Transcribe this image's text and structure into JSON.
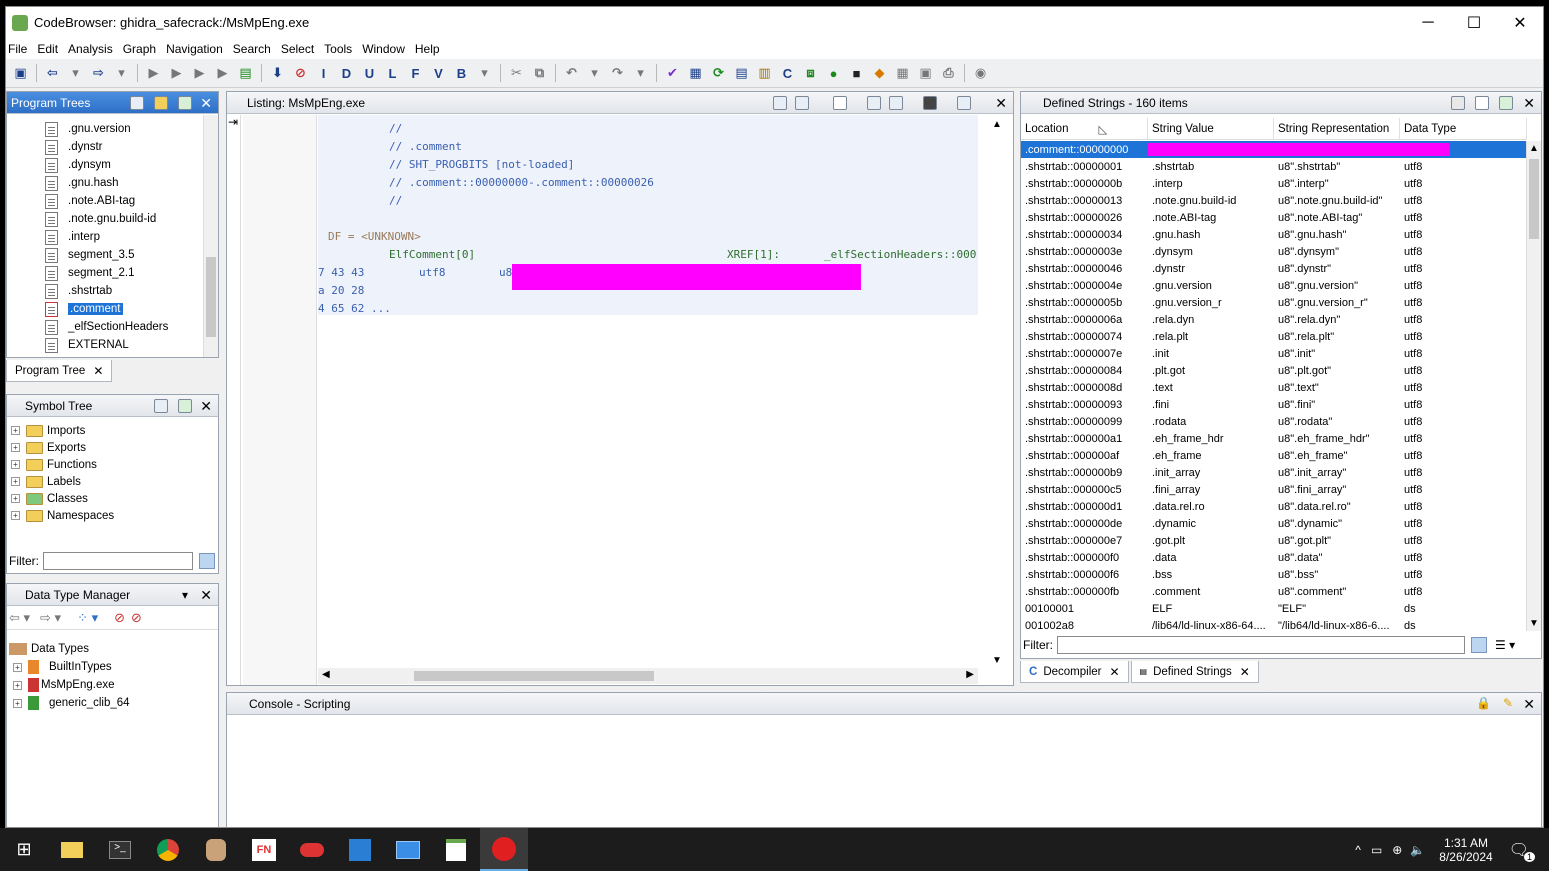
{
  "window": {
    "title": "CodeBrowser: ghidra_safecrack:/MsMpEng.exe",
    "minimize": "─",
    "maximize": "☐",
    "close": "✕"
  },
  "menu": [
    "File",
    "Edit",
    "Analysis",
    "Graph",
    "Navigation",
    "Search",
    "Select",
    "Tools",
    "Window",
    "Help"
  ],
  "toolbar_glyphs": [
    "I",
    "D",
    "U",
    "L",
    "F",
    "V",
    "B"
  ],
  "program_trees": {
    "title": "Program Trees",
    "items": [
      ".gnu.version",
      ".dynstr",
      ".dynsym",
      ".gnu.hash",
      ".note.ABI-tag",
      ".note.gnu.build-id",
      ".interp",
      "segment_3.5",
      "segment_2.1",
      ".shstrtab",
      ".comment",
      "_elfSectionHeaders",
      "EXTERNAL"
    ],
    "selected": ".comment",
    "tab_label": "Program Tree"
  },
  "symbol_tree": {
    "title": "Symbol Tree",
    "items": [
      "Imports",
      "Exports",
      "Functions",
      "Labels",
      "Classes",
      "Namespaces"
    ],
    "filter_label": "Filter:"
  },
  "data_type_manager": {
    "title": "Data Type Manager",
    "root": "Data Types",
    "items": [
      "BuiltInTypes",
      "MsMpEng.exe",
      "generic_clib_64"
    ]
  },
  "listing": {
    "title": "Listing:  MsMpEng.exe",
    "lines": [
      {
        "text": "//",
        "cls": "cmt"
      },
      {
        "text": "// .comment",
        "cls": "cmt"
      },
      {
        "text": "// SHT_PROGBITS [not-loaded]",
        "cls": "cmt"
      },
      {
        "text": "// .comment::00000000-.comment::00000026",
        "cls": "cmt"
      },
      {
        "text": "//",
        "cls": "cmt"
      },
      {
        "text": "DF = <UNKNOWN>",
        "cls": "grey"
      },
      {
        "text": "ElfComment[0]",
        "cls": "lbl"
      },
      {
        "text": "XREF[1]:",
        "cls": "lbl"
      },
      {
        "text": "_elfSectionHeaders::000",
        "cls": "lbl"
      },
      {
        "text": "7 43 43",
        "cls": "cmt"
      },
      {
        "text": "utf8",
        "cls": "cmt"
      },
      {
        "text": "u8",
        "cls": "cmt"
      },
      {
        "text": "a 20 28",
        "cls": "cmt"
      },
      {
        "text": "4 65 62 ...",
        "cls": "cmt"
      }
    ]
  },
  "defined_strings": {
    "title": "Defined Strings - 160 items",
    "columns": [
      "Location",
      "String Value",
      "String Representation",
      "Data Type"
    ],
    "rows": [
      {
        "loc": ".comment::00000000",
        "val": "",
        "rep": "",
        "type": ""
      },
      {
        "loc": ".shstrtab::00000001",
        "val": ".shstrtab",
        "rep": "u8\".shstrtab\"",
        "type": "utf8"
      },
      {
        "loc": ".shstrtab::0000000b",
        "val": ".interp",
        "rep": "u8\".interp\"",
        "type": "utf8"
      },
      {
        "loc": ".shstrtab::00000013",
        "val": ".note.gnu.build-id",
        "rep": "u8\".note.gnu.build-id\"",
        "type": "utf8"
      },
      {
        "loc": ".shstrtab::00000026",
        "val": ".note.ABI-tag",
        "rep": "u8\".note.ABI-tag\"",
        "type": "utf8"
      },
      {
        "loc": ".shstrtab::00000034",
        "val": ".gnu.hash",
        "rep": "u8\".gnu.hash\"",
        "type": "utf8"
      },
      {
        "loc": ".shstrtab::0000003e",
        "val": ".dynsym",
        "rep": "u8\".dynsym\"",
        "type": "utf8"
      },
      {
        "loc": ".shstrtab::00000046",
        "val": ".dynstr",
        "rep": "u8\".dynstr\"",
        "type": "utf8"
      },
      {
        "loc": ".shstrtab::0000004e",
        "val": ".gnu.version",
        "rep": "u8\".gnu.version\"",
        "type": "utf8"
      },
      {
        "loc": ".shstrtab::0000005b",
        "val": ".gnu.version_r",
        "rep": "u8\".gnu.version_r\"",
        "type": "utf8"
      },
      {
        "loc": ".shstrtab::0000006a",
        "val": ".rela.dyn",
        "rep": "u8\".rela.dyn\"",
        "type": "utf8"
      },
      {
        "loc": ".shstrtab::00000074",
        "val": ".rela.plt",
        "rep": "u8\".rela.plt\"",
        "type": "utf8"
      },
      {
        "loc": ".shstrtab::0000007e",
        "val": ".init",
        "rep": "u8\".init\"",
        "type": "utf8"
      },
      {
        "loc": ".shstrtab::00000084",
        "val": ".plt.got",
        "rep": "u8\".plt.got\"",
        "type": "utf8"
      },
      {
        "loc": ".shstrtab::0000008d",
        "val": ".text",
        "rep": "u8\".text\"",
        "type": "utf8"
      },
      {
        "loc": ".shstrtab::00000093",
        "val": ".fini",
        "rep": "u8\".fini\"",
        "type": "utf8"
      },
      {
        "loc": ".shstrtab::00000099",
        "val": ".rodata",
        "rep": "u8\".rodata\"",
        "type": "utf8"
      },
      {
        "loc": ".shstrtab::000000a1",
        "val": ".eh_frame_hdr",
        "rep": "u8\".eh_frame_hdr\"",
        "type": "utf8"
      },
      {
        "loc": ".shstrtab::000000af",
        "val": ".eh_frame",
        "rep": "u8\".eh_frame\"",
        "type": "utf8"
      },
      {
        "loc": ".shstrtab::000000b9",
        "val": ".init_array",
        "rep": "u8\".init_array\"",
        "type": "utf8"
      },
      {
        "loc": ".shstrtab::000000c5",
        "val": ".fini_array",
        "rep": "u8\".fini_array\"",
        "type": "utf8"
      },
      {
        "loc": ".shstrtab::000000d1",
        "val": ".data.rel.ro",
        "rep": "u8\".data.rel.ro\"",
        "type": "utf8"
      },
      {
        "loc": ".shstrtab::000000de",
        "val": ".dynamic",
        "rep": "u8\".dynamic\"",
        "type": "utf8"
      },
      {
        "loc": ".shstrtab::000000e7",
        "val": ".got.plt",
        "rep": "u8\".got.plt\"",
        "type": "utf8"
      },
      {
        "loc": ".shstrtab::000000f0",
        "val": ".data",
        "rep": "u8\".data\"",
        "type": "utf8"
      },
      {
        "loc": ".shstrtab::000000f6",
        "val": ".bss",
        "rep": "u8\".bss\"",
        "type": "utf8"
      },
      {
        "loc": ".shstrtab::000000fb",
        "val": ".comment",
        "rep": "u8\".comment\"",
        "type": "utf8"
      },
      {
        "loc": "00100001",
        "val": "ELF",
        "rep": "\"ELF\"",
        "type": "ds"
      },
      {
        "loc": "001002a8",
        "val": "/lib64/ld-linux-x86-64....",
        "rep": "\"/lib64/ld-linux-x86-6....",
        "type": "ds"
      }
    ],
    "filter_label": "Filter:",
    "tabs": [
      "Decompiler",
      "Defined Strings"
    ]
  },
  "console": {
    "title": "Console - Scripting"
  },
  "taskbar": {
    "time": "1:31 AM",
    "date": "8/26/2024",
    "notification_count": "1"
  },
  "colors": {
    "accent": "#1e74d6",
    "redaction": "#ff00ff"
  }
}
